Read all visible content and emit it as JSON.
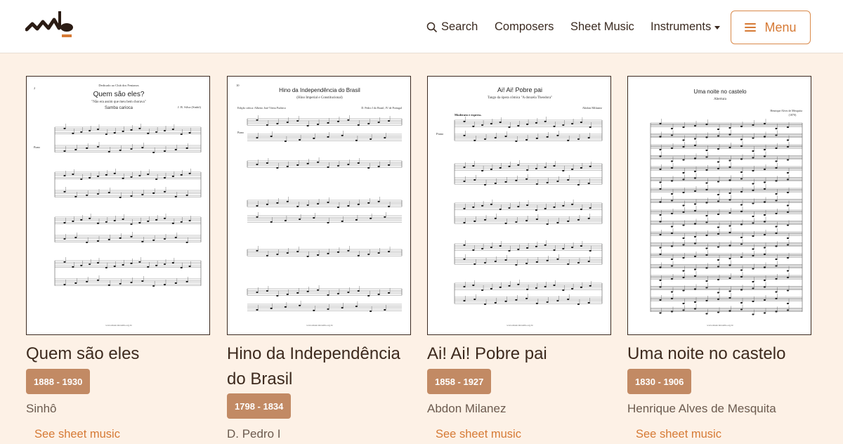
{
  "header": {
    "logo_icon": "musica-brasilis-logo",
    "search_label": "Search",
    "composers_label": "Composers",
    "sheet_music_label": "Sheet Music",
    "instruments_label": "Instruments",
    "menu_label": "Menu"
  },
  "colors": {
    "accent": "#d67a35",
    "badge": "#c28a64",
    "background": "#fdf1e6",
    "text": "#3d2a1e"
  },
  "works": [
    {
      "title": "Quem são eles",
      "dates": "1888 - 1930",
      "composer": "Sinhô",
      "link": "See sheet music",
      "sheet": {
        "page": "2",
        "dedication": "Dedicado ao Club dos Fenianos",
        "heading": "Quem são eles?",
        "subtitle": "\"Não era assim que meu bem chorava\"",
        "style": "Samba carioca",
        "author": "J. B. Silva (Sinhô)",
        "instrument": "Piano",
        "footer": "www.musicabrasilis.org.br"
      }
    },
    {
      "title": "Hino da Independência do Brasil",
      "dates": "1798 - 1834",
      "composer": "D. Pedro I",
      "link": "See sheet music",
      "sheet": {
        "page": "10",
        "heading": "Hino da Independência do Brasil",
        "subtitle": "(Hino Imperial e Constitucional)",
        "edition": "Edição crítica: Alberto José Vieira Pacheco",
        "author": "D. Pedro I do Brasil, IV de Portugal",
        "instrument": "Piano",
        "footer": "www.musicabrasilis.org.br"
      }
    },
    {
      "title": "Ai! Ai! Pobre pai",
      "dates": "1858 - 1927",
      "composer": "Abdon Milanez",
      "link": "See sheet music",
      "sheet": {
        "heading": "Ai! Ai! Pobre pai",
        "subtitle": "Tango da ópera cômica \"A donzela Theodora\"",
        "author": "Abdon Milanez",
        "tempo": "Moderato e express.",
        "instrument": "Piano",
        "footer": "www.musicabrasilis.org.br"
      }
    },
    {
      "title": "Uma noite no castelo",
      "dates": "1830 - 1906",
      "composer": "Henrique Alves de Mesquita",
      "link": "See sheet music",
      "sheet": {
        "heading": "Uma noite no castelo",
        "subtitle": "Abertura",
        "author": "Henrique Alves de Mesquita",
        "year": "(1870)",
        "footer": "www.musicabrasilis.org.br"
      }
    }
  ]
}
